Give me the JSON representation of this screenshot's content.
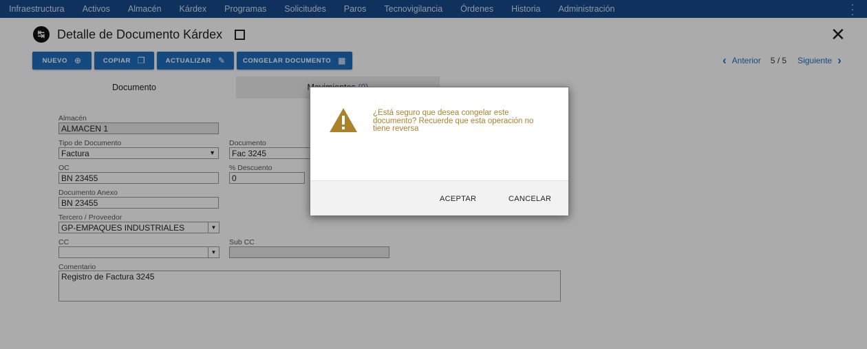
{
  "nav": {
    "items": [
      "Infraestructura",
      "Activos",
      "Almacén",
      "Kárdex",
      "Programas",
      "Solicitudes",
      "Paros",
      "Tecnovigilancia",
      "Órdenes",
      "Historia",
      "Administración"
    ],
    "more_icon": "more-vert-icon"
  },
  "header": {
    "title": "Detalle de Documento Kárdex",
    "icon": "kardex-icon",
    "close": "close-icon"
  },
  "toolbar": {
    "nuevo_label": "NUEVO",
    "copiar_label": "COPIAR",
    "actualizar_label": "ACTUALIZAR",
    "congelar_label": "CONGELAR DOCUMENTO",
    "button_color": "#1f6fbf"
  },
  "pager": {
    "prev_label": "Anterior",
    "count": "5 / 5",
    "next_label": "Siguiente"
  },
  "tabs": {
    "documento": "Documento",
    "movimientos": "Movimientos",
    "movimientos_count": "(0)"
  },
  "form": {
    "almacen": {
      "label": "Almacén",
      "value": "ALMACEN 1"
    },
    "tipo_documento": {
      "label": "Tipo de Documento",
      "value": "Factura"
    },
    "documento": {
      "label": "Documento",
      "value": "Fac 3245"
    },
    "oc": {
      "label": "OC",
      "value": "BN 23455"
    },
    "descuento": {
      "label": "% Descuento",
      "value": "0"
    },
    "documento_anexo": {
      "label": "Documento Anexo",
      "value": "BN 23455"
    },
    "tercero": {
      "label": "Tercero / Proveedor",
      "value": "GP-EMPAQUES INDUSTRIALES"
    },
    "cc": {
      "label": "CC",
      "value": ""
    },
    "sub_cc": {
      "label": "Sub CC",
      "value": ""
    },
    "comentario": {
      "label": "Comentario",
      "value": "Registro de Factura 3245"
    }
  },
  "dialog": {
    "message": "¿Está seguro que desea congelar este documento? Recuerde que esta operación no tiene reversa",
    "accept_label": "ACEPTAR",
    "cancel_label": "CANCELAR",
    "warning_color": "#a9822a"
  }
}
